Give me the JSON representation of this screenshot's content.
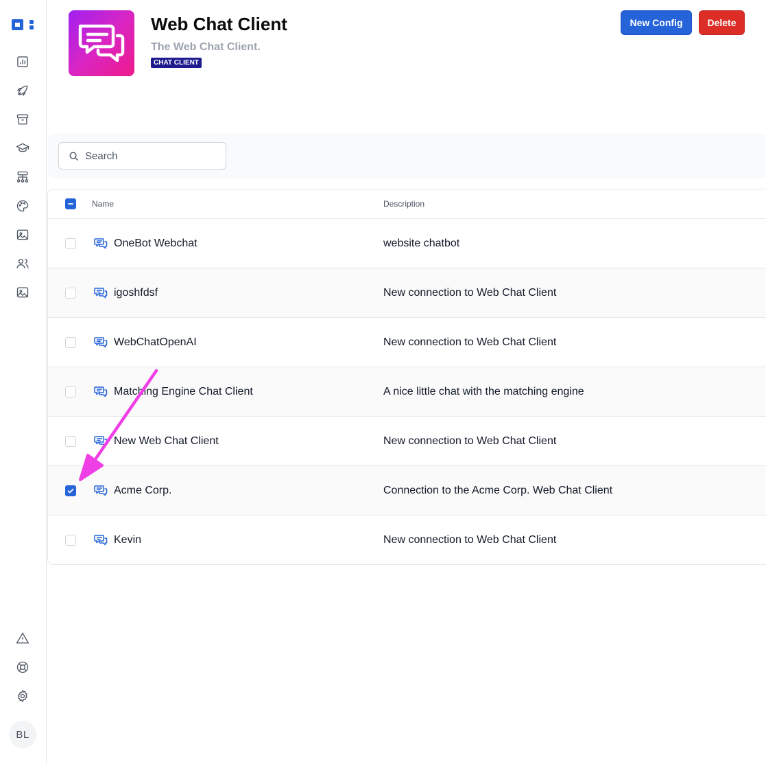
{
  "sidebar": {
    "logo_icon": "brand-logo-icon",
    "items": [
      {
        "icon": "chart-icon"
      },
      {
        "icon": "rocket-icon"
      },
      {
        "icon": "archive-icon"
      },
      {
        "icon": "graduation-cap-icon"
      },
      {
        "icon": "sitemap-icon"
      },
      {
        "icon": "palette-icon"
      },
      {
        "icon": "image-icon"
      },
      {
        "icon": "users-icon"
      },
      {
        "icon": "image-icon"
      }
    ],
    "bottom_items": [
      {
        "icon": "warning-icon"
      },
      {
        "icon": "lifebuoy-icon"
      },
      {
        "icon": "gear-icon"
      }
    ],
    "avatar_initials": "BL"
  },
  "header": {
    "app_icon": "chat-bubbles-icon",
    "title": "Web Chat Client",
    "subtitle": "The Web Chat Client.",
    "badge": "CHAT CLIENT",
    "new_config_label": "New Config",
    "delete_label": "Delete"
  },
  "search": {
    "placeholder": "Search",
    "value": ""
  },
  "table": {
    "header_checkbox_state": "indeterminate",
    "columns": [
      "Name",
      "Description"
    ],
    "rows": [
      {
        "name": "OneBot Webchat",
        "description": "website chatbot",
        "checked": false
      },
      {
        "name": "igoshfdsf",
        "description": "New connection to Web Chat Client",
        "checked": false
      },
      {
        "name": "WebChatOpenAI",
        "description": "New connection to Web Chat Client",
        "checked": false
      },
      {
        "name": "Matching Engine Chat Client",
        "description": "A nice little chat with the matching engine",
        "checked": false
      },
      {
        "name": "New Web Chat Client",
        "description": "New connection to Web Chat Client",
        "checked": false
      },
      {
        "name": "Acme Corp.",
        "description": "Connection to the Acme Corp. Web Chat Client",
        "checked": true
      },
      {
        "name": "Kevin",
        "description": "New connection to Web Chat Client",
        "checked": false
      }
    ]
  },
  "colors": {
    "accent": "#2563d9",
    "danger": "#dc2e26",
    "badge_bg": "#1e1b8f",
    "annotation_arrow": "#f03ee6"
  }
}
